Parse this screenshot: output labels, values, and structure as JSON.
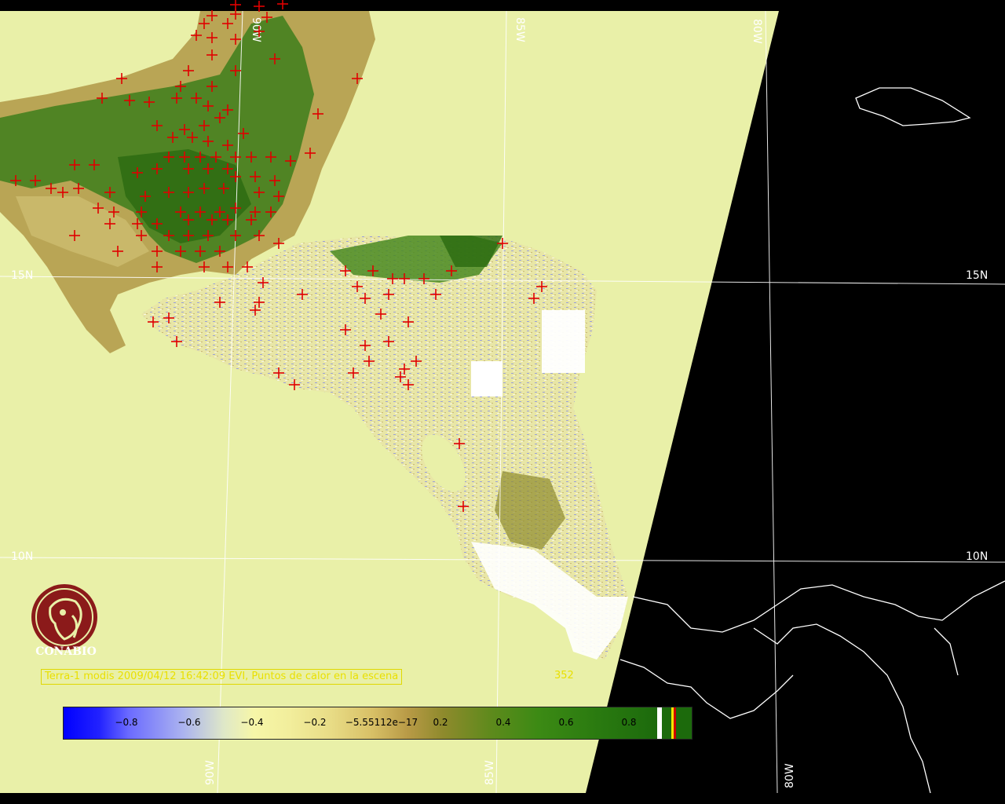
{
  "map": {
    "grid_labels": {
      "lon_top": [
        "90W",
        "85W",
        "80W"
      ],
      "lon_bottom": [
        "90W",
        "85W",
        "80W"
      ],
      "lat_left": [
        "15N",
        "10N"
      ],
      "lat_right": [
        "15N",
        "10N"
      ]
    },
    "colors": {
      "background": "#000000",
      "no_data": "#e9f0a8",
      "fire_marker": "#e00000",
      "coastline": "#ffffff",
      "grid": "#ffffff"
    }
  },
  "logo": {
    "text": "CONABIO",
    "icon": "conabio-logo-icon",
    "color": "#8b1a1a"
  },
  "caption": {
    "text": "Terra-1 modis 2009/04/12 16:42:09 EVI, Puntos de calor en la escena",
    "count": "352"
  },
  "colorbar": {
    "ticks": [
      "−0.8",
      "−0.6",
      "−0.4",
      "−0.2",
      "−5.55112e−17",
      "0.2",
      "0.4",
      "0.6",
      "0.8"
    ],
    "tick_values": [
      -0.8,
      -0.6,
      -0.4,
      -0.2,
      0,
      0.2,
      0.4,
      0.6,
      0.8
    ],
    "range": [
      -1,
      1
    ],
    "extra_classes_colors": [
      "#ffffff",
      "#1c6a0c",
      "#f6e600",
      "#d00000",
      "#1c6a0c"
    ]
  }
}
